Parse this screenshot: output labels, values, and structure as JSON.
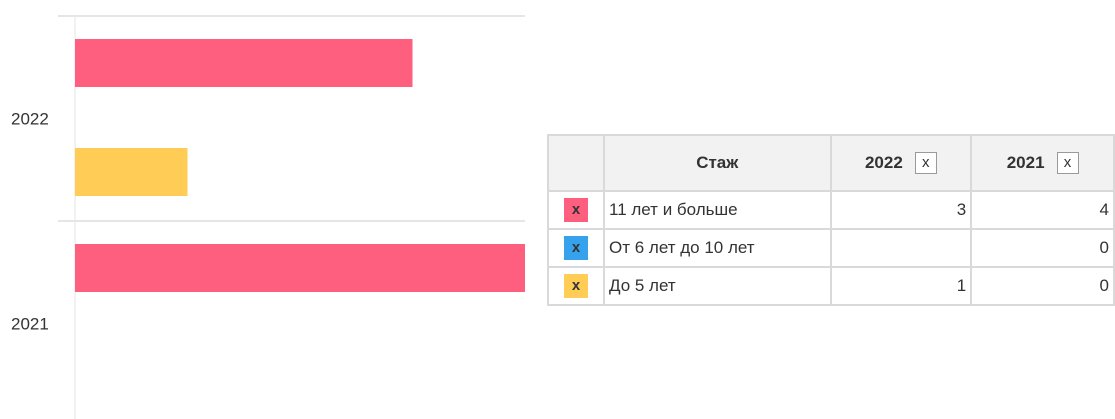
{
  "chart_data": {
    "type": "bar",
    "orientation": "horizontal",
    "categories": [
      "2022",
      "2021"
    ],
    "series": [
      {
        "name": "11 лет и больше",
        "color": "#ff5f7e",
        "values": [
          3,
          4
        ]
      },
      {
        "name": "От 6 лет до 10 лет",
        "color": "#36a2eb",
        "values": [
          null,
          0
        ]
      },
      {
        "name": "До 5 лет",
        "color": "#ffcd56",
        "values": [
          1,
          0
        ]
      }
    ],
    "xlim": [
      0,
      4
    ],
    "grid": true,
    "title": "",
    "xlabel": "",
    "ylabel": ""
  },
  "legend_table": {
    "header_label": "Стаж",
    "columns": [
      {
        "year": "2022",
        "close_label": "x"
      },
      {
        "year": "2021",
        "close_label": "x"
      }
    ],
    "rows": [
      {
        "swatch_label": "x",
        "color": "#ff5f7e",
        "label": "11 лет и больше",
        "values": [
          "3",
          "4"
        ]
      },
      {
        "swatch_label": "x",
        "color": "#36a2eb",
        "label": "От 6 лет до 10 лет",
        "values": [
          "",
          "0"
        ]
      },
      {
        "swatch_label": "x",
        "color": "#ffcd56",
        "label": "До 5 лет",
        "values": [
          "1",
          "0"
        ]
      }
    ]
  }
}
